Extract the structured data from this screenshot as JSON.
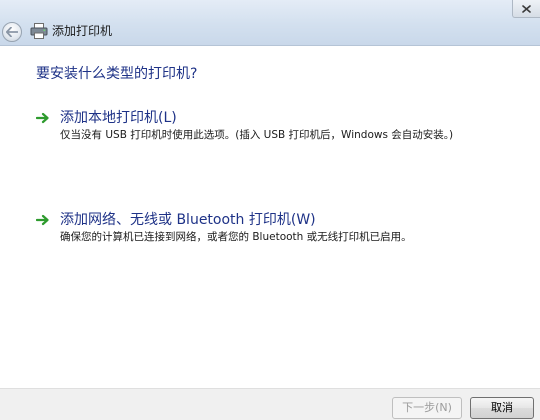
{
  "window": {
    "title": "添加打印机",
    "back_icon": "back-arrow-icon",
    "app_icon": "printer-icon",
    "close_icon": "close-icon"
  },
  "main": {
    "question": "要安装什么类型的打印机?",
    "options": [
      {
        "title": "添加本地打印机(L)",
        "description": "仅当没有 USB 打印机时使用此选项。(插入 USB 打印机后，Windows 会自动安装。)",
        "icon": "green-arrow-icon"
      },
      {
        "title": "添加网络、无线或 Bluetooth 打印机(W)",
        "description": "确保您的计算机已连接到网络，或者您的 Bluetooth 或无线打印机已启用。",
        "icon": "green-arrow-icon"
      }
    ]
  },
  "footer": {
    "next_label": "下一步(N)",
    "cancel_label": "取消"
  },
  "colors": {
    "heading": "#1e3287",
    "arrow": "#2e9b2e",
    "titlebar": "#d3e0ef",
    "footer": "#f0f0f0"
  }
}
